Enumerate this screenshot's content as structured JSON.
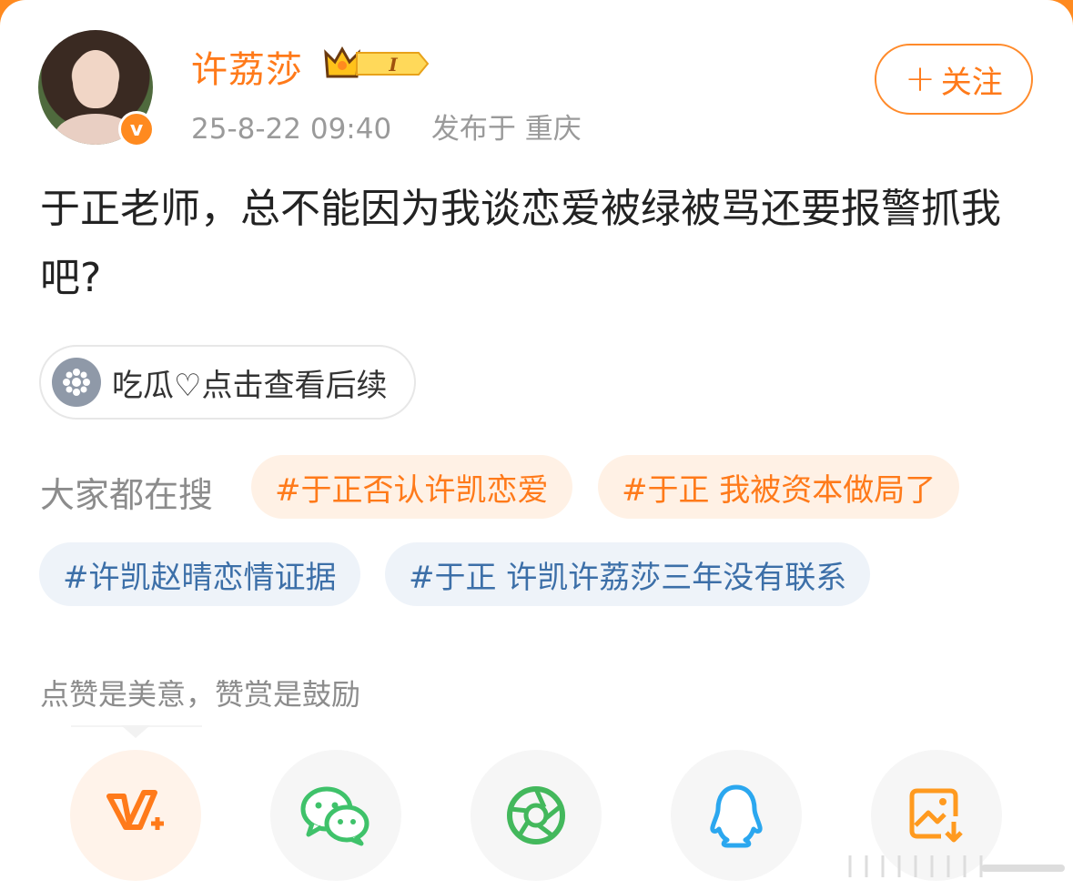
{
  "user": {
    "name": "许荔莎",
    "crown_badge_text": "I",
    "timestamp": "25-8-22 09:40",
    "location": "发布于 重庆",
    "verified_letter": "v"
  },
  "follow": {
    "plus": "+",
    "label": "关注"
  },
  "post": {
    "text": "于正老师，总不能因为我谈恋爱被绿被骂还要报警抓我吧?"
  },
  "chip": {
    "label": "吃瓜♡点击查看后续"
  },
  "hot_search": {
    "label": "大家都在搜",
    "tags": [
      "#于正否认许凯恋爱",
      "#于正 我被资本做局了",
      "#许凯赵晴恋情证据",
      "#于正 许凯许荔莎三年没有联系"
    ]
  },
  "reward": {
    "text": "点赞是美意，赞赏是鼓励"
  },
  "share_icons": [
    "weibo-vplus-icon",
    "wechat-icon",
    "moments-icon",
    "qq-icon",
    "save-image-icon"
  ],
  "colors": {
    "accent": "#ff7a1a",
    "tag_blue": "#3c6fa8",
    "wechat_green": "#3fc26a",
    "qq_blue": "#2ba7ef",
    "save_orange": "#ff9a1f"
  }
}
